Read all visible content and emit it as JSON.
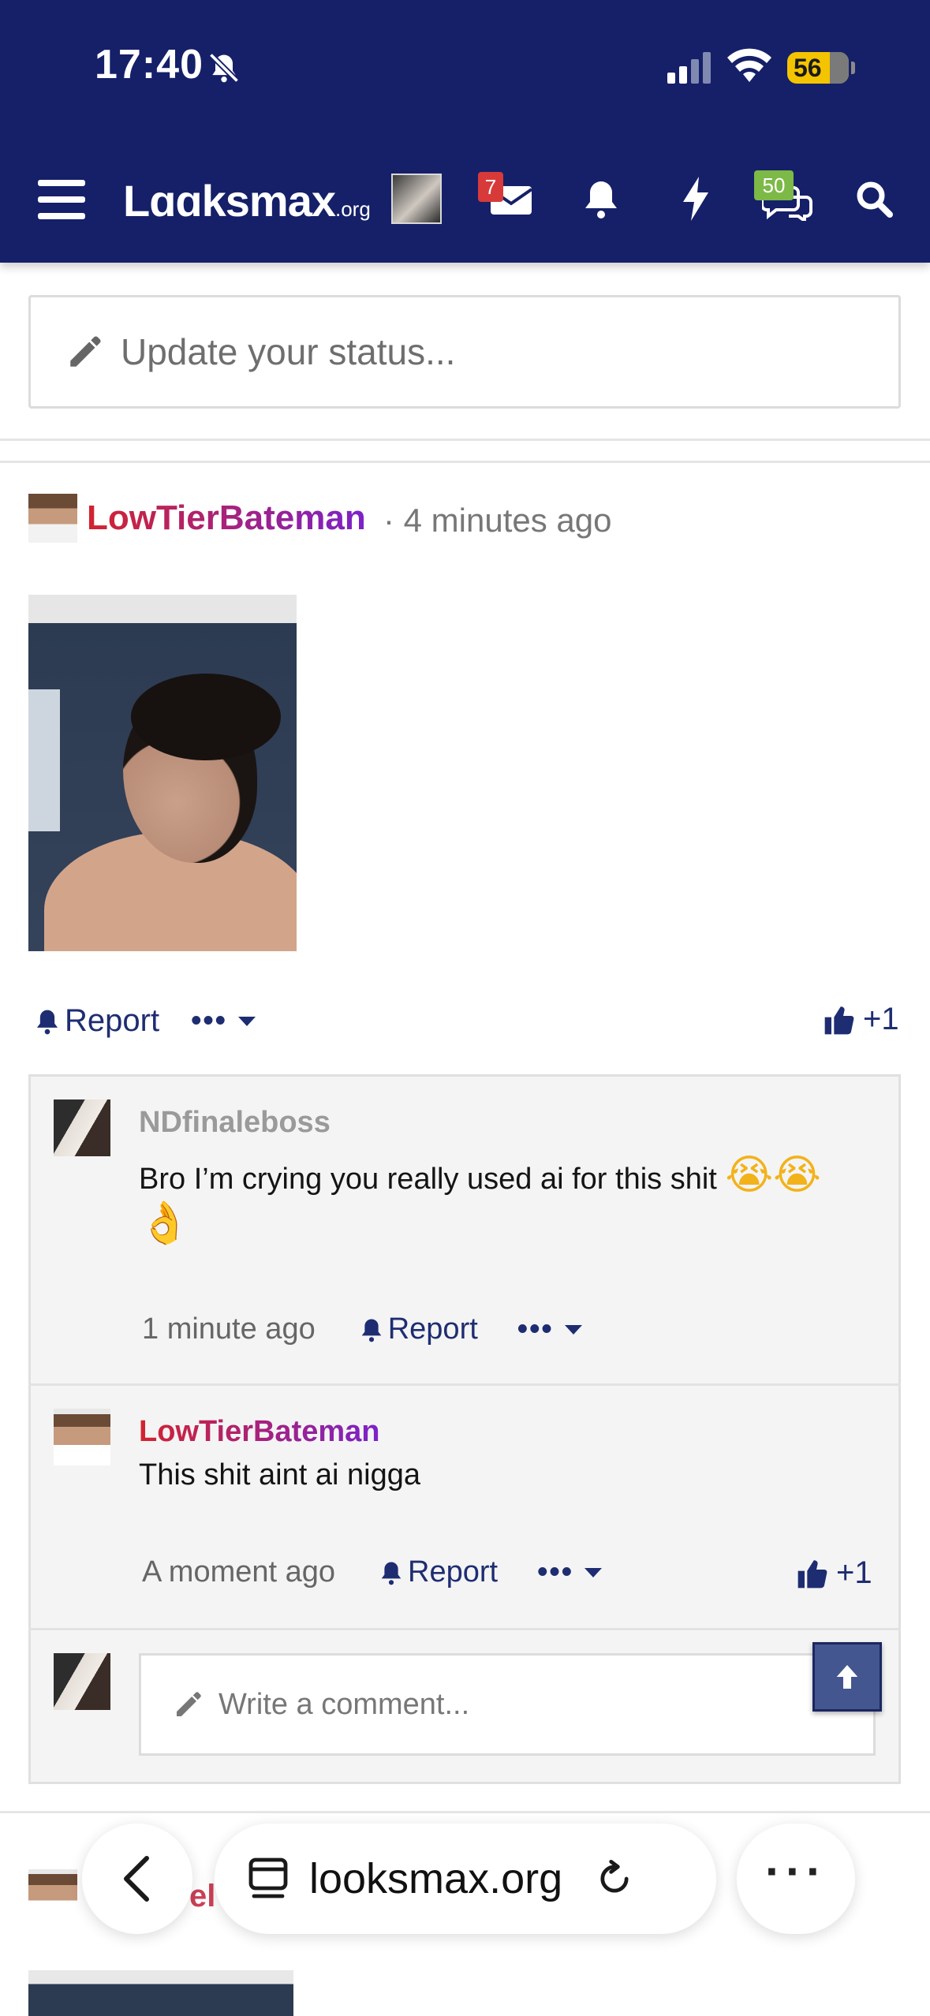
{
  "status_bar": {
    "time": "17:40",
    "battery": "56"
  },
  "header": {
    "logo": "Lɑɑksmax",
    "logo_suffix": ".org",
    "inbox_count": "7",
    "chat_count": "50"
  },
  "status_update": {
    "placeholder": "Update your status..."
  },
  "post": {
    "author": "LowTierBateman",
    "time": "· 4 minutes ago",
    "report_label": "Report",
    "more_label": "•••",
    "likes": "+1"
  },
  "comments": [
    {
      "author": "NDfinaleboss",
      "text": "Bro I’m crying you really used ai for this shit",
      "emojis": "😭😭",
      "emoji_line2": "👌",
      "time": "1 minute ago",
      "report_label": "Report",
      "more_label": "•••"
    },
    {
      "author": "LowTierBateman",
      "text": "This shit aint ai nigga",
      "time": "A moment ago",
      "report_label": "Report",
      "more_label": "•••",
      "likes": "+1"
    }
  ],
  "comment_input": {
    "placeholder": "Write a comment..."
  },
  "next_post": {
    "author_partial": "el"
  },
  "browser": {
    "url": "looksmax.org"
  }
}
